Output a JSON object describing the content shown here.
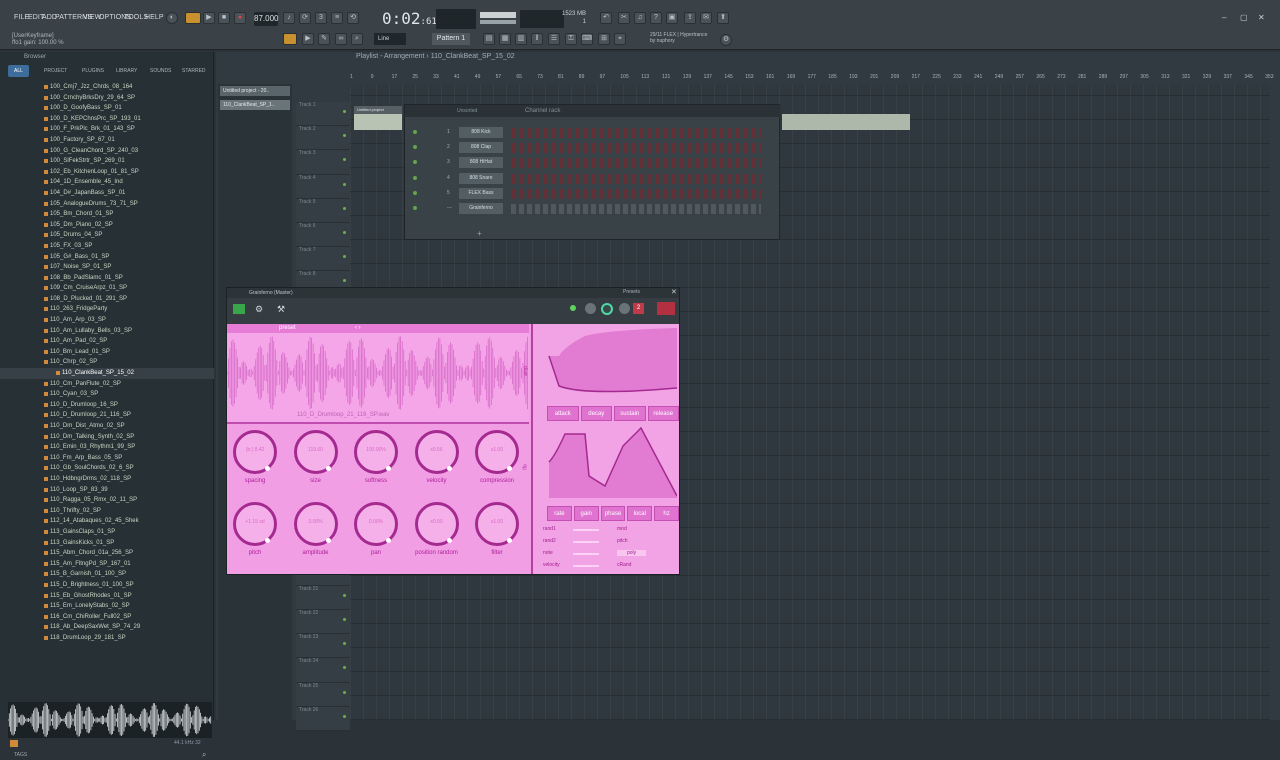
{
  "menu": [
    "FILE",
    "EDIT",
    "ADD",
    "PATTERNS",
    "VIEW",
    "OPTIONS",
    "TOOLS",
    "HELP"
  ],
  "tempo": "87.000",
  "timecode": "0:02",
  "timecode_ms": "61",
  "cpu": {
    "ram": "1523 MB",
    "poly": "1"
  },
  "hint": {
    "line1": "[UserKeyframe]",
    "line2": "ffo1 gain: 100.00 %"
  },
  "line_mode": "Line",
  "pattern": "Pattern 1",
  "news": {
    "line1": "29/11 FLEX | Hypertrance",
    "line2": "by nuphory"
  },
  "browser": {
    "title": "Browser",
    "tabs": [
      "ALL",
      "PROJECT",
      "PLUGINS",
      "LIBRARY",
      "SOUNDS",
      "STARRED"
    ],
    "files": [
      "100_Cmj7_Jzz_Chrds_08_164",
      "100_CrnchyBrksDry_29_64_SP",
      "100_D_GoofyBass_SP_01",
      "100_D_KEPChnsPrc_SP_193_01",
      "100_F_PrkPlc_Brk_01_143_SP",
      "100_Factory_SP_67_01",
      "100_G_CleanChord_SP_240_03",
      "100_SlFekStrtr_SP_269_01",
      "102_Eb_KitchenLoop_01_81_SP",
      "104_1D_Ensemble_45_Ind",
      "104_D#_JapanBass_SP_01",
      "105_AnalogueDrums_73_71_SP",
      "105_Bm_Chord_01_SP",
      "105_Dm_Piano_02_SP",
      "105_Drums_04_SP",
      "105_FX_03_SP",
      "105_G#_Bass_01_SP",
      "107_Noise_SP_01_SP",
      "108_Bb_PadSlamc_01_SP",
      "109_Cm_CruiseArpz_01_SP",
      "108_D_Plucked_01_291_SP",
      "110_263_FridgeParty",
      "110_Am_Arp_03_SP",
      "110_Am_Lullaby_Bells_03_SP",
      "110_Am_Pad_02_SP",
      "110_Bm_Lead_01_SP",
      "110_Chrp_02_SP",
      "110_ClankBeat_SP_15_02",
      "110_Cm_PanFlute_02_SP",
      "110_Cyan_03_SP",
      "110_D_Drumloop_16_SP",
      "110_D_Drumloop_21_116_SP",
      "110_Dm_Dist_Atmo_02_SP",
      "110_Dm_Talking_Synth_02_SP",
      "110_Emin_03_Rhythm1_99_SP",
      "110_Fm_Arp_Bass_05_SP",
      "110_Gb_SoulChords_02_6_SP",
      "110_HdbngrDrms_02_118_SP",
      "110_Loop_SP_83_39",
      "110_Ragga_05_Rmx_02_11_SP",
      "110_Thrifty_02_SP",
      "112_14_Atabaques_02_45_Shek",
      "113_GainsClaps_01_SP",
      "113_GainsKicks_01_SP",
      "115_Abm_Chord_01a_256_SP",
      "115_Am_FltngPd_SP_167_01",
      "115_B_Garnish_01_100_SP",
      "115_D_Brightness_01_100_SP",
      "115_Eb_GhostRhodes_01_SP",
      "115_Em_LonelyStabs_02_SP",
      "116_Cm_ChiRoller_Full02_SP",
      "118_Ab_DeepSaxWet_SP_74_29",
      "118_DrumLoop_29_181_SP"
    ],
    "selected_index": 27,
    "tags_label": "TAGS",
    "sample_info": "44.1 kHz 32"
  },
  "playlist": {
    "title": "Playlist - Arrangement  ›  110_ClankBeat_SP_15_02",
    "picker": [
      "Untitled project - 20..",
      "110_ClankBeat_SP_1.."
    ],
    "ruler": [
      "1",
      "9",
      "17",
      "25",
      "33",
      "41",
      "49",
      "57",
      "65",
      "73",
      "81",
      "89",
      "97",
      "105",
      "113",
      "121",
      "129",
      "137",
      "145",
      "153",
      "161",
      "169",
      "177",
      "185",
      "193",
      "201",
      "209",
      "217",
      "225",
      "233",
      "241",
      "249",
      "257",
      "265",
      "273",
      "281",
      "289",
      "297",
      "305",
      "313",
      "321",
      "329",
      "337",
      "345",
      "353"
    ],
    "tracks": [
      "Track 1",
      "Track 2",
      "Track 3",
      "Track 4",
      "Track 5",
      "Track 6",
      "Track 7",
      "Track 8",
      "Track 9",
      "Track 10",
      "Track 11",
      "Track 12",
      "Track 13",
      "Track 14",
      "Track 15",
      "Track 16",
      "Track 17",
      "Track 18",
      "Track 19",
      "Track 20",
      "Track 21",
      "Track 22",
      "Track 23",
      "Track 24",
      "Track 25",
      "Track 26"
    ]
  },
  "rack": {
    "title": "Channel rack",
    "filter": "Unsorted",
    "clip_name": "Untitled project",
    "channels": [
      {
        "num": "1",
        "name": "808 Kick"
      },
      {
        "num": "2",
        "name": "808 Clap"
      },
      {
        "num": "3",
        "name": "808 HiHat"
      },
      {
        "num": "4",
        "name": "808 Snare"
      },
      {
        "num": "5",
        "name": "FLEX Bass"
      },
      {
        "num": "---",
        "name": "Grainferno"
      }
    ]
  },
  "plugin": {
    "title": "Grainferno (Master)",
    "presets": "Presets",
    "preset_label": "preset",
    "sample_name": "110_D_Drumloop_21_116_SP.wav",
    "knobs_row1": [
      {
        "label": "spacing",
        "value": "(b:) 8.42"
      },
      {
        "label": "size",
        "value": "119.60"
      },
      {
        "label": "softness",
        "value": "100.00%"
      },
      {
        "label": "velocity",
        "value": "x0.56"
      },
      {
        "label": "compression",
        "value": "x1.00"
      }
    ],
    "knobs_row2": [
      {
        "label": "pitch",
        "value": "+1.15 sd"
      },
      {
        "label": "amplitude",
        "value": "3.00%"
      },
      {
        "label": "pan",
        "value": "0.00%"
      },
      {
        "label": "position random",
        "value": "x0.00"
      },
      {
        "label": "filter",
        "value": "x1.00"
      }
    ],
    "env_buttons": [
      "attack",
      "decay",
      "sustain",
      "release"
    ],
    "lfo_buttons": [
      "rate",
      "gain",
      "phase",
      "local",
      "hz"
    ],
    "mod_left": [
      "rand1",
      "rand2",
      "note",
      "velocity"
    ],
    "mod_right": [
      "mod",
      "pitch",
      "poly",
      "cRand"
    ],
    "side_labels": [
      "amp",
      "lfo"
    ]
  },
  "colors": {
    "accent": "#f19ee4",
    "dark": "#a42a90"
  }
}
